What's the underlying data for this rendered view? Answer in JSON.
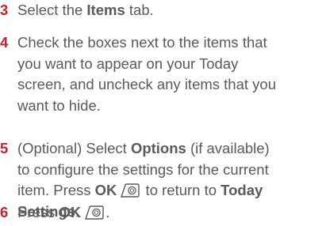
{
  "steps": [
    {
      "number": "3",
      "lines": [
        [
          {
            "t": "Select the "
          },
          {
            "t": "Items",
            "b": true
          },
          {
            "t": " tab."
          }
        ]
      ]
    },
    {
      "number": "4",
      "lines": [
        [
          {
            "t": "Check the boxes next to the items that"
          }
        ],
        [
          {
            "t": "you want to appear on your Today"
          }
        ],
        [
          {
            "t": "screen, and uncheck any items that you"
          }
        ],
        [
          {
            "t": "want to hide."
          }
        ]
      ]
    },
    {
      "number": "5",
      "lines": [
        [
          {
            "t": "(Optional) Select "
          },
          {
            "t": "Options",
            "b": true
          },
          {
            "t": " (if available)"
          }
        ],
        [
          {
            "t": "to configure the settings for the current"
          }
        ],
        [
          {
            "t": "item. Press "
          },
          {
            "t": "OK",
            "b": true
          },
          {
            "icon": "ok-button-icon"
          },
          {
            "t": " to return to "
          },
          {
            "t": "Today",
            "b": true
          }
        ],
        [
          {
            "t": "Settings",
            "b": true
          },
          {
            "t": "."
          }
        ]
      ]
    },
    {
      "number": "6",
      "lines": [
        [
          {
            "t": "Press "
          },
          {
            "t": "OK",
            "b": true
          },
          {
            "icon": "ok-button-icon"
          },
          {
            "t": "."
          }
        ]
      ]
    }
  ],
  "colors": {
    "step_number": "#c8202f",
    "body_text": "#5a5a5a"
  }
}
